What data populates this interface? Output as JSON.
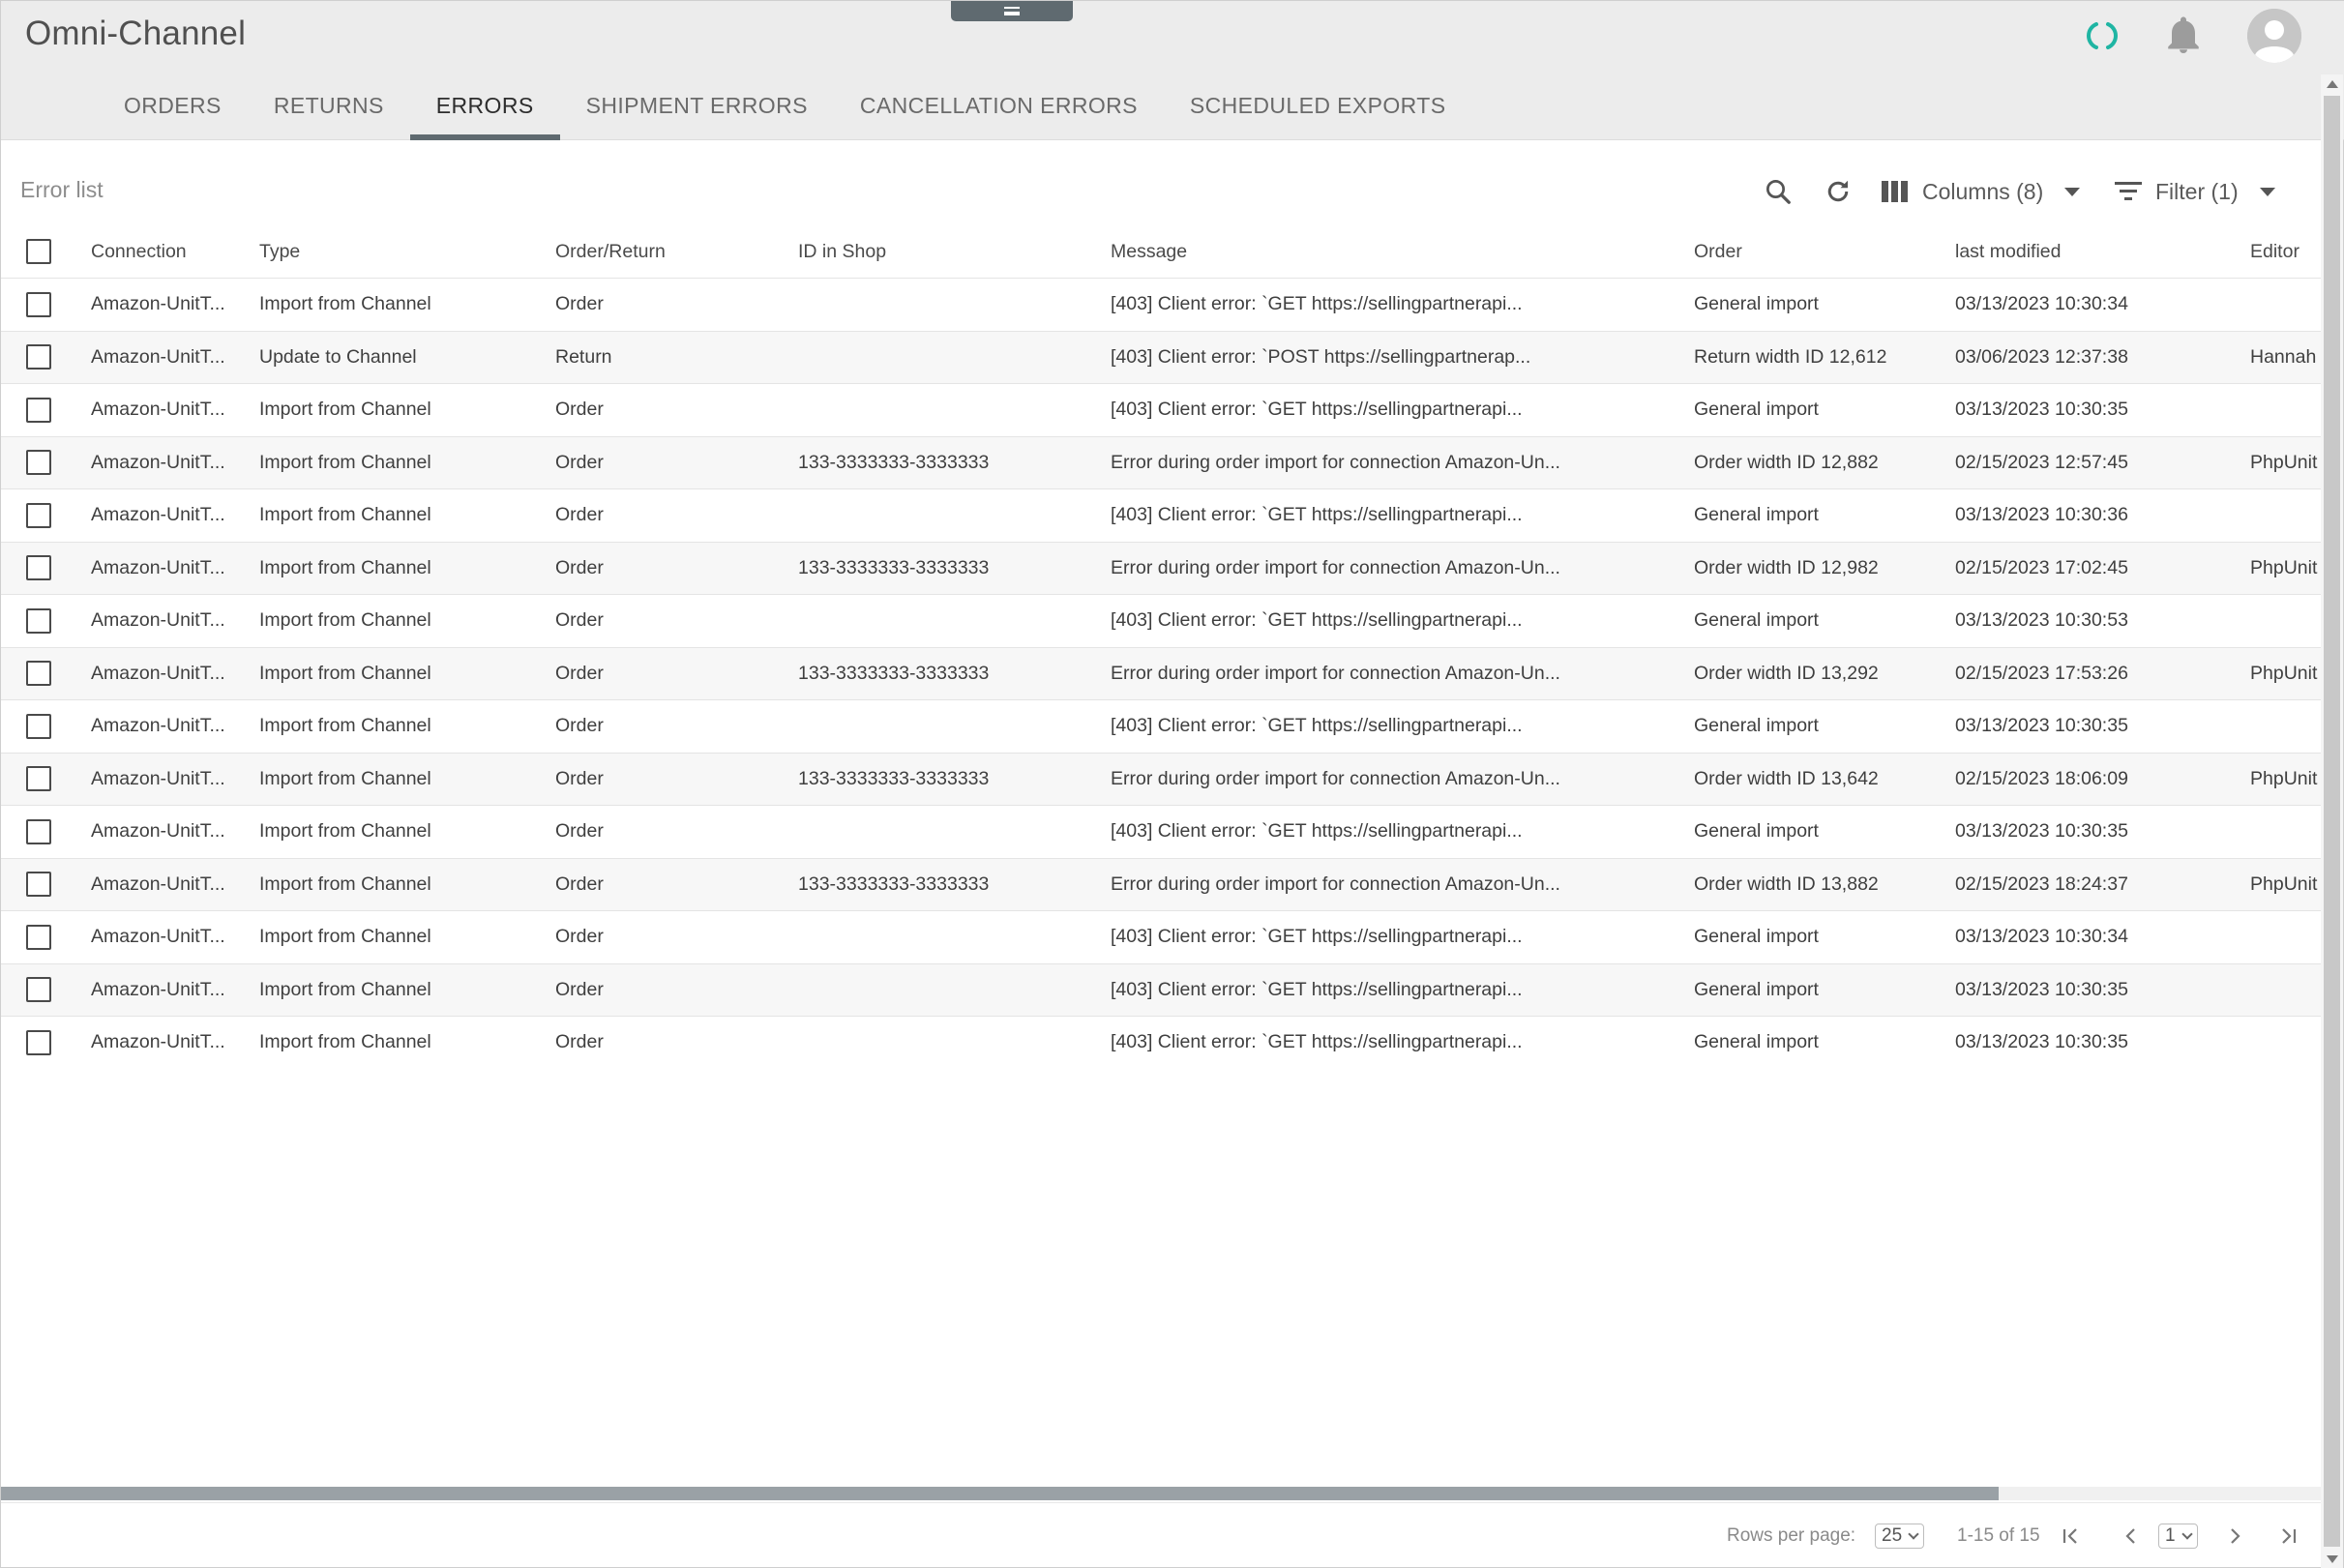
{
  "header": {
    "title": "Omni-Channel",
    "tabs": [
      {
        "label": "ORDERS",
        "active": false
      },
      {
        "label": "RETURNS",
        "active": false
      },
      {
        "label": "ERRORS",
        "active": true
      },
      {
        "label": "SHIPMENT ERRORS",
        "active": false
      },
      {
        "label": "CANCELLATION ERRORS",
        "active": false
      },
      {
        "label": "SCHEDULED EXPORTS",
        "active": false
      }
    ],
    "icons": [
      "drawer-handle-icon",
      "loading-spinner-icon",
      "bell-icon",
      "user-avatar-icon"
    ],
    "accent_color": "#1fb5a3"
  },
  "toolbar": {
    "list_title": "Error list",
    "columns_label": "Columns (8)",
    "filter_label": "Filter (1)"
  },
  "table": {
    "columns": [
      "Connection",
      "Type",
      "Order/Return",
      "ID in Shop",
      "Message",
      "Order",
      "last modified",
      "Editor"
    ],
    "rows": [
      {
        "connection": "Amazon-UnitT...",
        "type": "Import from Channel",
        "order_return": "Order",
        "id_in_shop": "",
        "message": "[403] Client error: `GET https://sellingpartnerapi...",
        "order": "General import",
        "last_modified": "03/13/2023 10:30:34",
        "editor": ""
      },
      {
        "connection": "Amazon-UnitT...",
        "type": "Update to Channel",
        "order_return": "Return",
        "id_in_shop": "",
        "message": "[403] Client error: `POST https://sellingpartnerap...",
        "order": "Return width ID 12,612",
        "last_modified": "03/06/2023 12:37:38",
        "editor": "Hannah"
      },
      {
        "connection": "Amazon-UnitT...",
        "type": "Import from Channel",
        "order_return": "Order",
        "id_in_shop": "",
        "message": "[403] Client error: `GET https://sellingpartnerapi...",
        "order": "General import",
        "last_modified": "03/13/2023 10:30:35",
        "editor": ""
      },
      {
        "connection": "Amazon-UnitT...",
        "type": "Import from Channel",
        "order_return": "Order",
        "id_in_shop": "133-3333333-3333333",
        "message": "Error during order import for connection Amazon-Un...",
        "order": "Order width ID 12,882",
        "last_modified": "02/15/2023 12:57:45",
        "editor": "PhpUnit"
      },
      {
        "connection": "Amazon-UnitT...",
        "type": "Import from Channel",
        "order_return": "Order",
        "id_in_shop": "",
        "message": "[403] Client error: `GET https://sellingpartnerapi...",
        "order": "General import",
        "last_modified": "03/13/2023 10:30:36",
        "editor": ""
      },
      {
        "connection": "Amazon-UnitT...",
        "type": "Import from Channel",
        "order_return": "Order",
        "id_in_shop": "133-3333333-3333333",
        "message": "Error during order import for connection Amazon-Un...",
        "order": "Order width ID 12,982",
        "last_modified": "02/15/2023 17:02:45",
        "editor": "PhpUnit"
      },
      {
        "connection": "Amazon-UnitT...",
        "type": "Import from Channel",
        "order_return": "Order",
        "id_in_shop": "",
        "message": "[403] Client error: `GET https://sellingpartnerapi...",
        "order": "General import",
        "last_modified": "03/13/2023 10:30:53",
        "editor": ""
      },
      {
        "connection": "Amazon-UnitT...",
        "type": "Import from Channel",
        "order_return": "Order",
        "id_in_shop": "133-3333333-3333333",
        "message": "Error during order import for connection Amazon-Un...",
        "order": "Order width ID 13,292",
        "last_modified": "02/15/2023 17:53:26",
        "editor": "PhpUnit"
      },
      {
        "connection": "Amazon-UnitT...",
        "type": "Import from Channel",
        "order_return": "Order",
        "id_in_shop": "",
        "message": "[403] Client error: `GET https://sellingpartnerapi...",
        "order": "General import",
        "last_modified": "03/13/2023 10:30:35",
        "editor": ""
      },
      {
        "connection": "Amazon-UnitT...",
        "type": "Import from Channel",
        "order_return": "Order",
        "id_in_shop": "133-3333333-3333333",
        "message": "Error during order import for connection Amazon-Un...",
        "order": "Order width ID 13,642",
        "last_modified": "02/15/2023 18:06:09",
        "editor": "PhpUnit"
      },
      {
        "connection": "Amazon-UnitT...",
        "type": "Import from Channel",
        "order_return": "Order",
        "id_in_shop": "",
        "message": "[403] Client error: `GET https://sellingpartnerapi...",
        "order": "General import",
        "last_modified": "03/13/2023 10:30:35",
        "editor": ""
      },
      {
        "connection": "Amazon-UnitT...",
        "type": "Import from Channel",
        "order_return": "Order",
        "id_in_shop": "133-3333333-3333333",
        "message": "Error during order import for connection Amazon-Un...",
        "order": "Order width ID 13,882",
        "last_modified": "02/15/2023 18:24:37",
        "editor": "PhpUnit"
      },
      {
        "connection": "Amazon-UnitT...",
        "type": "Import from Channel",
        "order_return": "Order",
        "id_in_shop": "",
        "message": "[403] Client error: `GET https://sellingpartnerapi...",
        "order": "General import",
        "last_modified": "03/13/2023 10:30:34",
        "editor": ""
      },
      {
        "connection": "Amazon-UnitT...",
        "type": "Import from Channel",
        "order_return": "Order",
        "id_in_shop": "",
        "message": "[403] Client error: `GET https://sellingpartnerapi...",
        "order": "General import",
        "last_modified": "03/13/2023 10:30:35",
        "editor": ""
      },
      {
        "connection": "Amazon-UnitT...",
        "type": "Import from Channel",
        "order_return": "Order",
        "id_in_shop": "",
        "message": "[403] Client error: `GET https://sellingpartnerapi...",
        "order": "General import",
        "last_modified": "03/13/2023 10:30:35",
        "editor": ""
      }
    ]
  },
  "footer": {
    "rows_per_page_label": "Rows per page:",
    "rows_per_page_value": "25",
    "range_text": "1-15 of 15",
    "page_value": "1"
  }
}
